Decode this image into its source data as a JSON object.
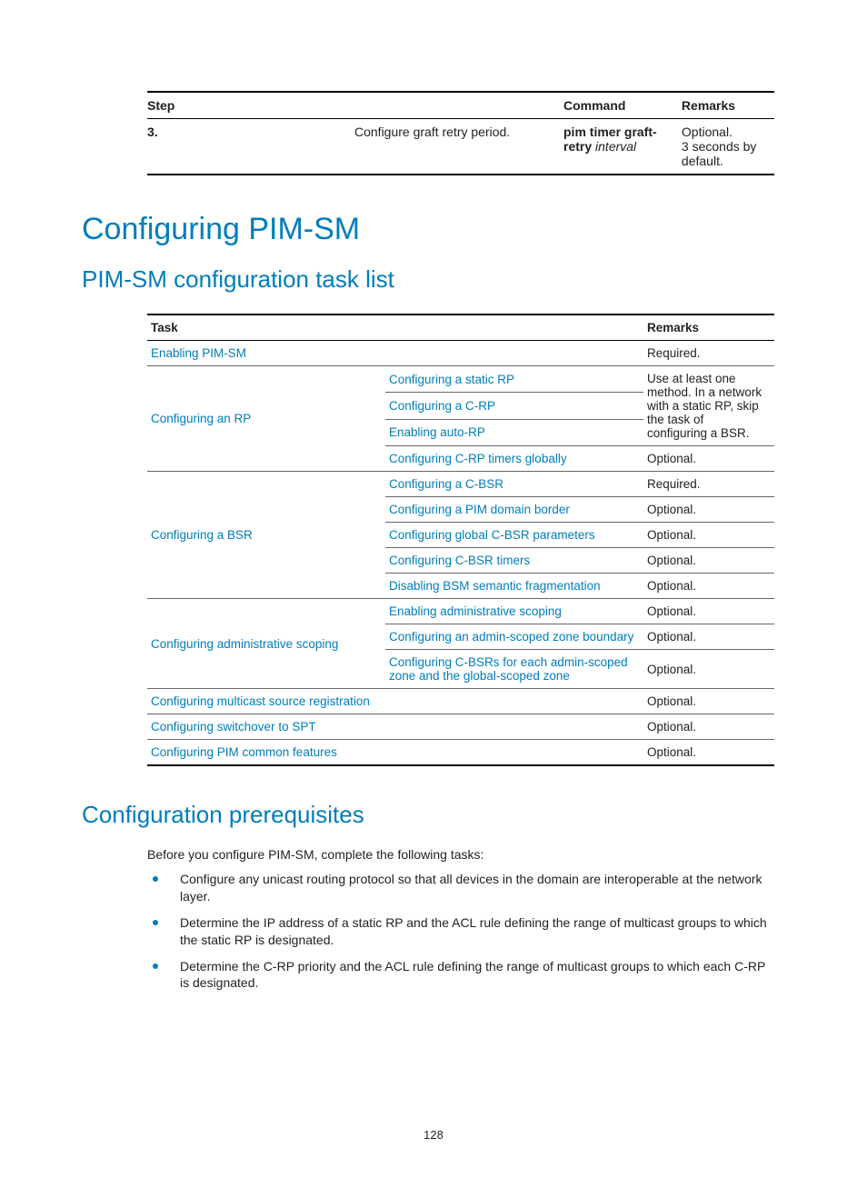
{
  "step_table": {
    "headers": {
      "step": "Step",
      "command": "Command",
      "remarks": "Remarks"
    },
    "row": {
      "num": "3.",
      "desc": "Configure graft retry period.",
      "cmd_bold": "pim timer graft-retry",
      "cmd_ital": "interval",
      "rem1": "Optional.",
      "rem2": "3 seconds by default."
    }
  },
  "h1": "Configuring PIM-SM",
  "h2_tasklist": "PIM-SM configuration task list",
  "task_table": {
    "headers": {
      "task": "Task",
      "remarks": "Remarks"
    },
    "r_enable_pimsm": {
      "task": "Enabling PIM-SM",
      "rem": "Required."
    },
    "grp_rp": {
      "task": "Configuring an RP",
      "sub_static_rp": "Configuring a static RP",
      "sub_crp": "Configuring a C-RP",
      "sub_autorp": "Enabling auto-RP",
      "sub_crp_timers": "Configuring C-RP timers globally",
      "rem_block": "Use at least one method. In a network with a static RP, skip the task of configuring a BSR.",
      "rem_crp_timers": "Optional."
    },
    "grp_bsr": {
      "task": "Configuring a BSR",
      "sub_cbsr": "Configuring a C-BSR",
      "sub_border": "Configuring a PIM domain border",
      "sub_global_cbsr": "Configuring global C-BSR parameters",
      "sub_cbsr_timers": "Configuring C-BSR timers",
      "sub_disable_bsm": "Disabling BSM semantic fragmentation",
      "rem_cbsr": "Required.",
      "rem_border": "Optional.",
      "rem_global_cbsr": "Optional.",
      "rem_cbsr_timers": "Optional.",
      "rem_disable_bsm": "Optional."
    },
    "grp_admin": {
      "task": "Configuring administrative scoping",
      "sub_enable": "Enabling administrative scoping",
      "sub_boundary": "Configuring an admin-scoped zone boundary",
      "sub_cbsrs": "Configuring C-BSRs for each admin-scoped zone and the global-scoped zone",
      "rem_enable": "Optional.",
      "rem_boundary": "Optional.",
      "rem_cbsrs": "Optional."
    },
    "r_msrc": {
      "task": "Configuring multicast source registration",
      "rem": "Optional."
    },
    "r_spt": {
      "task": "Configuring switchover to SPT",
      "rem": "Optional."
    },
    "r_common": {
      "task": "Configuring PIM common features",
      "rem": "Optional."
    }
  },
  "h2_prereq": "Configuration prerequisites",
  "prereq_intro": "Before you configure PIM-SM, complete the following tasks:",
  "prereq_items": [
    "Configure any unicast routing protocol so that all devices in the domain are interoperable at the network layer.",
    "Determine the IP address of a static RP and the ACL rule defining the range of multicast groups to which the static RP is designated.",
    "Determine the C-RP priority and the ACL rule defining the range of multicast groups to which each C-RP is designated."
  ],
  "page_number": "128"
}
